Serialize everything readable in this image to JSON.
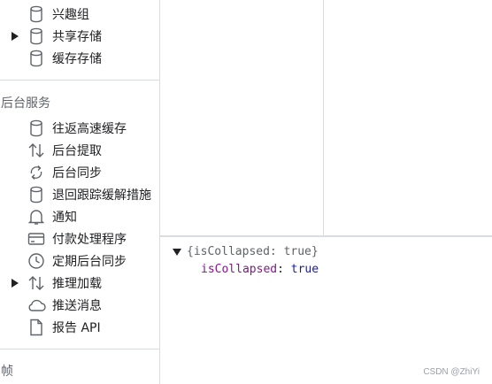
{
  "sidebar": {
    "storage_items": [
      {
        "label": "兴趣组",
        "icon": "database-icon",
        "expandable": false
      },
      {
        "label": "共享存储",
        "icon": "database-icon",
        "expandable": true
      },
      {
        "label": "缓存存储",
        "icon": "database-icon",
        "expandable": false
      }
    ],
    "background_services": {
      "title": "后台服务",
      "items": [
        {
          "label": "往返高速缓存",
          "icon": "database-icon",
          "expandable": false
        },
        {
          "label": "后台提取",
          "icon": "up-down-arrows-icon",
          "expandable": false
        },
        {
          "label": "后台同步",
          "icon": "sync-icon",
          "expandable": false
        },
        {
          "label": "退回跟踪缓解措施",
          "icon": "database-icon",
          "expandable": false
        },
        {
          "label": "通知",
          "icon": "bell-icon",
          "expandable": false
        },
        {
          "label": "付款处理程序",
          "icon": "credit-card-icon",
          "expandable": false
        },
        {
          "label": "定期后台同步",
          "icon": "clock-icon",
          "expandable": false
        },
        {
          "label": "推理加载",
          "icon": "up-down-arrows-icon",
          "expandable": true
        },
        {
          "label": "推送消息",
          "icon": "cloud-icon",
          "expandable": false
        },
        {
          "label": "报告 API",
          "icon": "document-icon",
          "expandable": false
        }
      ]
    },
    "frames_title": "帧"
  },
  "console": {
    "object_summary": "{isCollapsed: true}",
    "property_key": "isCollapsed",
    "property_value": "true"
  },
  "watermark": "CSDN @ZhiYi"
}
